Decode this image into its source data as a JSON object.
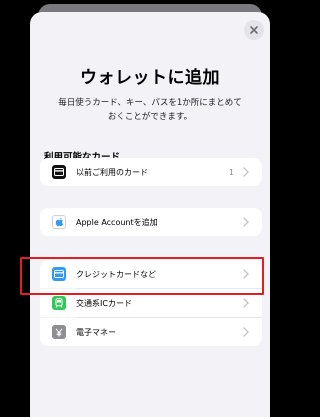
{
  "header": {
    "title": "ウォレットに追加",
    "description_line1": "毎日使うカード、キー、パスを1か所にまとめて",
    "description_line2": "おくことができます。"
  },
  "section": {
    "label": "利用可能なカード"
  },
  "items": [
    {
      "label": "以前ご利用のカード",
      "count": "1",
      "icon": "wallet-card-icon",
      "icon_color": "#111111"
    },
    {
      "label": "Apple Accountを追加",
      "icon": "apple-logo-icon",
      "icon_color": "#ffffff"
    },
    {
      "label": "クレジットカードなど",
      "icon": "credit-card-icon",
      "icon_color": "#2f9bf4"
    },
    {
      "label": "交通系ICカード",
      "icon": "train-icon",
      "icon_color": "#34c759"
    },
    {
      "label": "電子マネー",
      "icon": "yen-icon",
      "icon_color": "#8e8e93"
    }
  ],
  "colors": {
    "highlight": "#e02020",
    "accent": "#2f9bf4"
  }
}
